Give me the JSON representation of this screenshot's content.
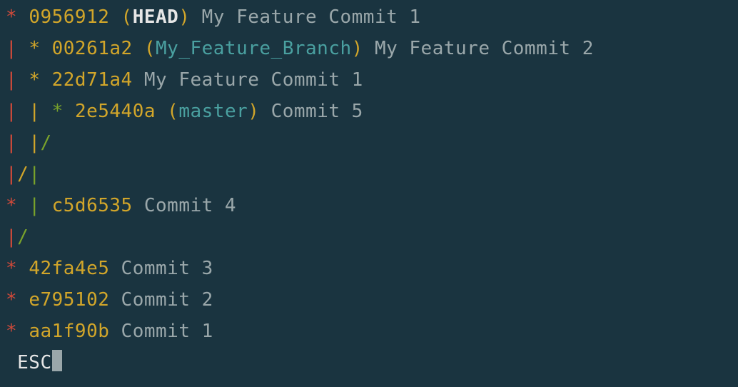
{
  "lines": [
    {
      "graph": [
        {
          "t": "*",
          "c": "red"
        }
      ],
      "hash": "0956912",
      "refs": [
        {
          "open": "(",
          "close": ")",
          "open_c": "yellow",
          "close_c": "yellow",
          "parts": [
            {
              "t": "HEAD",
              "c": "whitebold"
            }
          ]
        }
      ],
      "msg": "My Feature Commit 1"
    },
    {
      "graph": [
        {
          "t": "|",
          "c": "red"
        },
        {
          "t": " ",
          "c": "gray"
        },
        {
          "t": "*",
          "c": "yellow"
        }
      ],
      "hash": "00261a2",
      "refs": [
        {
          "open": "(",
          "close": ")",
          "open_c": "yellow",
          "close_c": "yellow",
          "parts": [
            {
              "t": "My_Feature_Branch",
              "c": "cyan"
            }
          ]
        }
      ],
      "msg": "My Feature Commit 2"
    },
    {
      "graph": [
        {
          "t": "|",
          "c": "red"
        },
        {
          "t": " ",
          "c": "gray"
        },
        {
          "t": "*",
          "c": "yellow"
        }
      ],
      "hash": "22d71a4",
      "refs": [],
      "msg": "My Feature Commit 1"
    },
    {
      "graph": [
        {
          "t": "|",
          "c": "red"
        },
        {
          "t": " ",
          "c": "gray"
        },
        {
          "t": "|",
          "c": "yellow"
        },
        {
          "t": " ",
          "c": "gray"
        },
        {
          "t": "*",
          "c": "green"
        }
      ],
      "hash": "2e5440a",
      "refs": [
        {
          "open": "(",
          "close": ")",
          "open_c": "yellow",
          "close_c": "yellow",
          "parts": [
            {
              "t": "master",
              "c": "cyan"
            }
          ]
        }
      ],
      "msg": "Commit 5"
    },
    {
      "graph": [
        {
          "t": "|",
          "c": "red"
        },
        {
          "t": " ",
          "c": "gray"
        },
        {
          "t": "|",
          "c": "yellow"
        },
        {
          "t": "/",
          "c": "green"
        }
      ],
      "hash": null,
      "refs": [],
      "msg": null
    },
    {
      "graph": [
        {
          "t": "|",
          "c": "red"
        },
        {
          "t": "/",
          "c": "yellow"
        },
        {
          "t": "|",
          "c": "green"
        }
      ],
      "hash": null,
      "refs": [],
      "msg": null
    },
    {
      "graph": [
        {
          "t": "*",
          "c": "red"
        },
        {
          "t": " ",
          "c": "gray"
        },
        {
          "t": "|",
          "c": "green"
        }
      ],
      "hash": "c5d6535",
      "refs": [],
      "msg": "Commit 4"
    },
    {
      "graph": [
        {
          "t": "|",
          "c": "red"
        },
        {
          "t": "/",
          "c": "green"
        }
      ],
      "hash": null,
      "refs": [],
      "msg": null
    },
    {
      "graph": [
        {
          "t": "*",
          "c": "red"
        }
      ],
      "hash": "42fa4e5",
      "refs": [],
      "msg": "Commit 3"
    },
    {
      "graph": [
        {
          "t": "*",
          "c": "red"
        }
      ],
      "hash": "e795102",
      "refs": [],
      "msg": "Commit 2"
    },
    {
      "graph": [
        {
          "t": "*",
          "c": "red"
        }
      ],
      "hash": "aa1f90b",
      "refs": [],
      "msg": "Commit 1"
    }
  ],
  "prompt": {
    "esc": "ESC"
  }
}
